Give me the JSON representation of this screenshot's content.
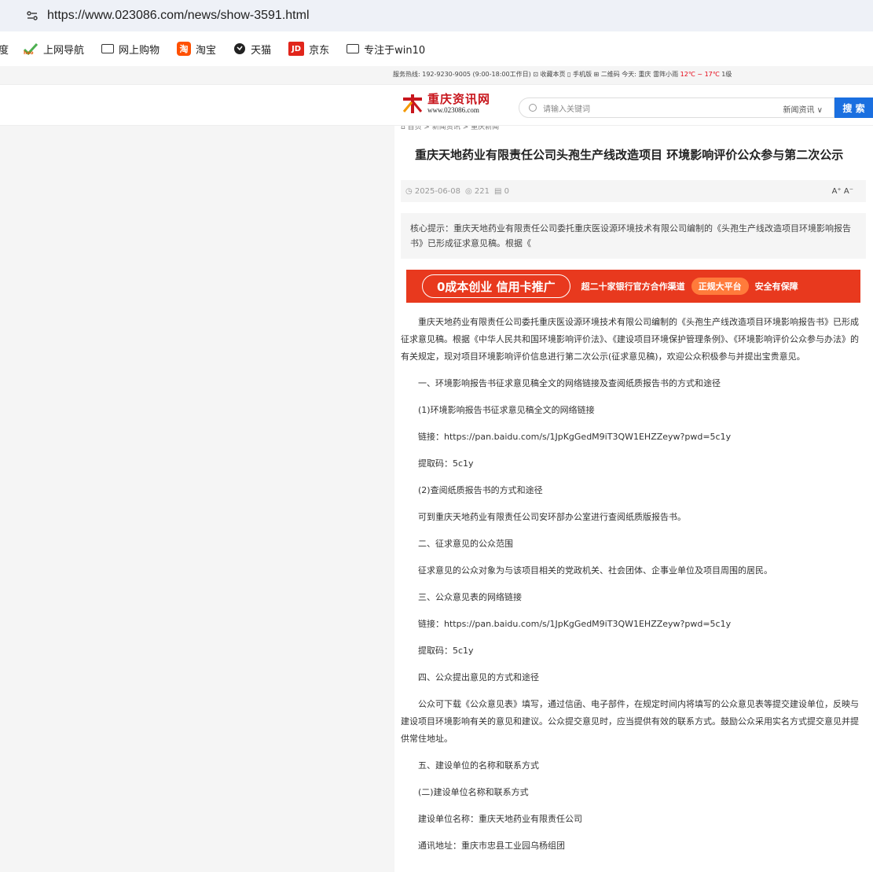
{
  "browser": {
    "url": "https://www.023086.com/news/show-3591.html",
    "bookmarks": [
      {
        "label": "度",
        "icon": "partial-baidu"
      },
      {
        "label": "上网导航",
        "icon": "hao-icon"
      },
      {
        "label": "网上购物",
        "icon": "folder-icon"
      },
      {
        "label": "淘宝",
        "icon": "taobao-icon"
      },
      {
        "label": "天猫",
        "icon": "tmall-icon"
      },
      {
        "label": "京东",
        "icon": "jd-icon"
      },
      {
        "label": "专注于win10",
        "icon": "folder-icon"
      }
    ]
  },
  "site": {
    "topinfo_left": "服务热线: 192-9230-9005 (9:00-18:00工作日)  ⊡ 收藏本页  ▯ 手机版  ⊞ 二维码  今天: 重庆 雷阵小雨 ",
    "temp": "12℃ ~ 17℃",
    "topinfo_right": " 1级",
    "logo_cn": "重庆资讯网",
    "logo_en": "www.023086.com",
    "search_placeholder": "请输入关键词",
    "search_category": "新闻资讯 ∨",
    "search_button": "搜 索",
    "breadcrumb": "⌂ 首页 > 新闻资讯 > 重庆新闻"
  },
  "article": {
    "title": "重庆天地药业有限责任公司头孢生产线改造项目 环境影响评价公众参与第二次公示",
    "date": "◷ 2025-06-08",
    "views": "◎ 221",
    "comments": "▤ 0",
    "font_ctl": "A⁺ A⁻",
    "summary": "核心提示：重庆天地药业有限责任公司委托重庆医设源环境技术有限公司编制的《头孢生产线改造项目环境影响报告书》已形成征求意见稿。根据《",
    "banner": {
      "main": "0成本创业 信用卡推广",
      "t2": "超二十家银行官方合作渠道",
      "pill": "正规大平台",
      "t3": "安全有保障"
    },
    "paragraphs": [
      {
        "text": "重庆天地药业有限责任公司委托重庆医设源环境技术有限公司编制的《头孢生产线改造项目环境影响报告书》已形成征求意见稿。根据《中华人民共和国环境影响评价法》、《建设项目环境保护管理条例》、《环境影响评价公众参与办法》的有关规定，现对项目环境影响评价信息进行第二次公示(征求意见稿)，欢迎公众积极参与并提出宝贵意见。",
        "style": "indent"
      },
      {
        "text": "一、环境影响报告书征求意见稿全文的网络链接及查阅纸质报告书的方式和途径",
        "style": "sub"
      },
      {
        "text": "(1)环境影响报告书征求意见稿全文的网络链接",
        "style": "sub"
      },
      {
        "text": "链接：https://pan.baidu.com/s/1JpKgGedM9iT3QW1EHZZeyw?pwd=5c1y",
        "style": "sub"
      },
      {
        "text": "提取码：5c1y",
        "style": "sub"
      },
      {
        "text": "(2)查阅纸质报告书的方式和途径",
        "style": "sub"
      },
      {
        "text": "可到重庆天地药业有限责任公司安环部办公室进行查阅纸质版报告书。",
        "style": "sub"
      },
      {
        "text": "二、征求意见的公众范围",
        "style": "sub"
      },
      {
        "text": "征求意见的公众对象为与该项目相关的党政机关、社会团体、企事业单位及项目周围的居民。",
        "style": "sub"
      },
      {
        "text": "三、公众意见表的网络链接",
        "style": "sub"
      },
      {
        "text": "链接：https://pan.baidu.com/s/1JpKgGedM9iT3QW1EHZZeyw?pwd=5c1y",
        "style": "sub"
      },
      {
        "text": "提取码：5c1y",
        "style": "sub"
      },
      {
        "text": "四、公众提出意见的方式和途径",
        "style": "sub"
      },
      {
        "text": "公众可下载《公众意见表》填写，通过信函、电子部件，在规定时间内将填写的公众意见表等提交建设单位，反映与建设项目环境影响有关的意见和建议。公众提交意见时，应当提供有效的联系方式。鼓励公众采用实名方式提交意见并提供常住地址。",
        "style": "indent"
      },
      {
        "text": "五、建设单位的名称和联系方式",
        "style": "sub"
      },
      {
        "text": "(二)建设单位名称和联系方式",
        "style": "sub"
      },
      {
        "text": "建设单位名称：重庆天地药业有限责任公司",
        "style": "sub"
      },
      {
        "text": "通讯地址：重庆市忠县工业园乌杨组团",
        "style": "sub"
      }
    ]
  },
  "colors": {
    "accent_blue": "#1a6fe0",
    "brand_red": "#c8161d",
    "banner_red": "#e8391e"
  }
}
